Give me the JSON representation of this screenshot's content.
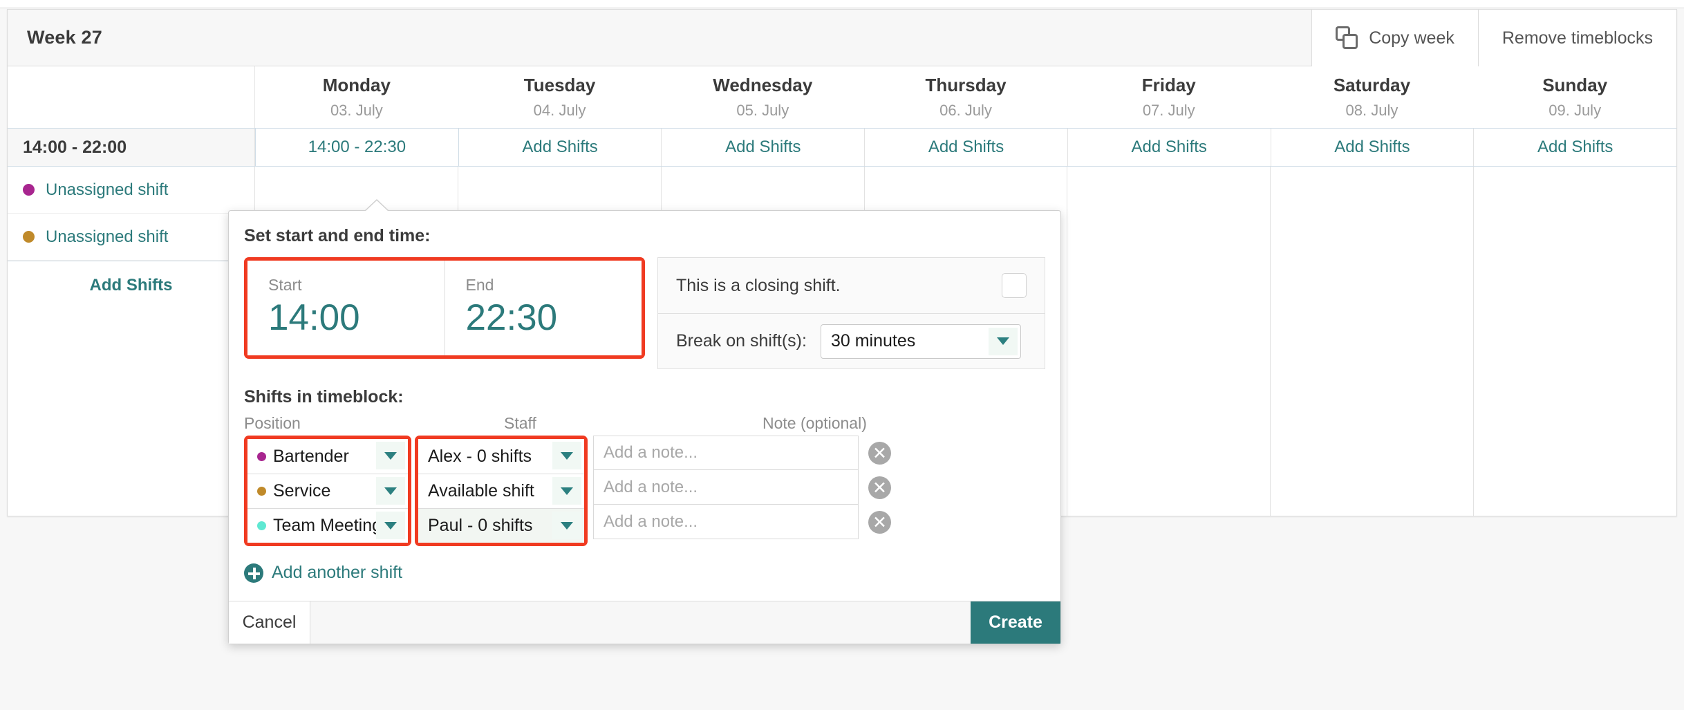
{
  "header": {
    "week_title": "Week 27",
    "copy_week_label": "Copy week",
    "remove_timeblocks_label": "Remove timeblocks"
  },
  "days": [
    {
      "name": "Monday",
      "date": "03. July"
    },
    {
      "name": "Tuesday",
      "date": "04. July"
    },
    {
      "name": "Wednesday",
      "date": "05. July"
    },
    {
      "name": "Thursday",
      "date": "06. July"
    },
    {
      "name": "Friday",
      "date": "07. July"
    },
    {
      "name": "Saturday",
      "date": "08. July"
    },
    {
      "name": "Sunday",
      "date": "09. July"
    }
  ],
  "timeblock_row": {
    "label": "14:00 - 22:00",
    "cells": [
      "14:00 - 22:30",
      "Add Shifts",
      "Add Shifts",
      "Add Shifts",
      "Add Shifts",
      "Add Shifts",
      "Add Shifts"
    ]
  },
  "left_column": {
    "shifts": [
      {
        "label": "Unassigned shift",
        "color": "#a8258f"
      },
      {
        "label": "Unassigned shift",
        "color": "#c08a2a"
      }
    ],
    "add_shifts_label": "Add Shifts"
  },
  "popup": {
    "time_section_title": "Set start and end time:",
    "start_label": "Start",
    "start_value": "14:00",
    "end_label": "End",
    "end_value": "22:30",
    "closing_shift_label": "This is a closing shift.",
    "closing_shift_checked": false,
    "break_label": "Break on shift(s):",
    "break_value": "30 minutes",
    "shifts_section_title": "Shifts in timeblock:",
    "columns": {
      "position": "Position",
      "staff": "Staff",
      "note": "Note (optional)"
    },
    "note_placeholder": "Add a note...",
    "rows": [
      {
        "position": "Bartender",
        "position_color": "#a8258f",
        "staff": "Alex - 0 shifts",
        "note": ""
      },
      {
        "position": "Service",
        "position_color": "#c08a2a",
        "staff": "Available shift",
        "note": ""
      },
      {
        "position": "Team Meeting",
        "position_color": "#5fe8d2",
        "staff": "Paul - 0 shifts",
        "note": ""
      }
    ],
    "add_another_label": "Add another shift",
    "cancel_label": "Cancel",
    "create_label": "Create",
    "delete_icon_glyph": "✕"
  },
  "colors": {
    "accent_teal": "#2c7a7b",
    "highlight_red": "#f03a21"
  }
}
